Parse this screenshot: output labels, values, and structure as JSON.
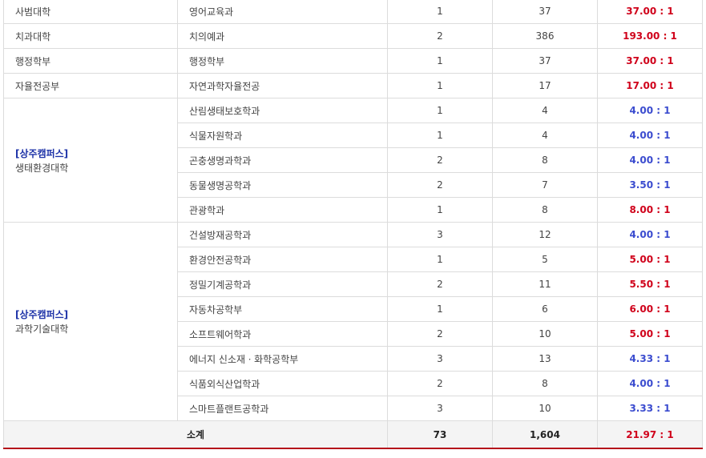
{
  "colors": {
    "high": "#d0021b",
    "low": "#3b4ccf",
    "campus": "#1e33a8"
  },
  "rows": [
    {
      "college": "사범대학",
      "dept": "영어교육과",
      "quota": "1",
      "applicants": "37",
      "ratio": "37.00 : 1",
      "tone": "red"
    },
    {
      "college": "치과대학",
      "dept": "치의예과",
      "quota": "2",
      "applicants": "386",
      "ratio": "193.00 : 1",
      "tone": "red"
    },
    {
      "college": "행정학부",
      "dept": "행정학부",
      "quota": "1",
      "applicants": "37",
      "ratio": "37.00 : 1",
      "tone": "red"
    },
    {
      "college": "자율전공부",
      "dept": "자연과학자율전공",
      "quota": "1",
      "applicants": "17",
      "ratio": "17.00 : 1",
      "tone": "red"
    }
  ],
  "groups": [
    {
      "campus": "[상주캠퍼스]",
      "college": "생태환경대학",
      "depts": [
        {
          "dept": "산림생태보호학과",
          "quota": "1",
          "applicants": "4",
          "ratio": "4.00 : 1",
          "tone": "blue"
        },
        {
          "dept": "식물자원학과",
          "quota": "1",
          "applicants": "4",
          "ratio": "4.00 : 1",
          "tone": "blue"
        },
        {
          "dept": "곤충생명과학과",
          "quota": "2",
          "applicants": "8",
          "ratio": "4.00 : 1",
          "tone": "blue"
        },
        {
          "dept": "동물생명공학과",
          "quota": "2",
          "applicants": "7",
          "ratio": "3.50 : 1",
          "tone": "blue"
        },
        {
          "dept": "관광학과",
          "quota": "1",
          "applicants": "8",
          "ratio": "8.00 : 1",
          "tone": "red"
        }
      ]
    },
    {
      "campus": "[상주캠퍼스]",
      "college": "과학기술대학",
      "depts": [
        {
          "dept": "건설방재공학과",
          "quota": "3",
          "applicants": "12",
          "ratio": "4.00 : 1",
          "tone": "blue"
        },
        {
          "dept": "환경안전공학과",
          "quota": "1",
          "applicants": "5",
          "ratio": "5.00 : 1",
          "tone": "red"
        },
        {
          "dept": "정밀기계공학과",
          "quota": "2",
          "applicants": "11",
          "ratio": "5.50 : 1",
          "tone": "red"
        },
        {
          "dept": "자동차공학부",
          "quota": "1",
          "applicants": "6",
          "ratio": "6.00 : 1",
          "tone": "red"
        },
        {
          "dept": "소프트웨어학과",
          "quota": "2",
          "applicants": "10",
          "ratio": "5.00 : 1",
          "tone": "red"
        },
        {
          "dept": "에너지 신소재ㆍ화학공학부",
          "quota": "3",
          "applicants": "13",
          "ratio": "4.33 : 1",
          "tone": "blue"
        },
        {
          "dept": "식품외식산업학과",
          "quota": "2",
          "applicants": "8",
          "ratio": "4.00 : 1",
          "tone": "blue"
        },
        {
          "dept": "스마트플랜트공학과",
          "quota": "3",
          "applicants": "10",
          "ratio": "3.33 : 1",
          "tone": "blue"
        }
      ]
    }
  ],
  "subtotal": {
    "label": "소계",
    "quota": "73",
    "applicants": "1,604",
    "ratio": "21.97 : 1"
  }
}
